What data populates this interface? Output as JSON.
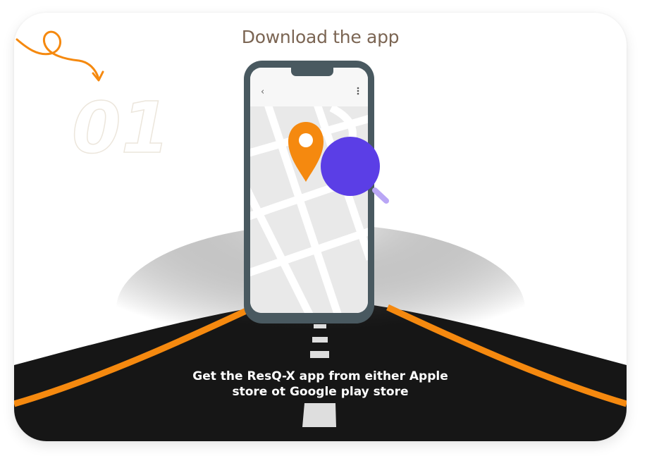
{
  "step": {
    "number": "01",
    "title": "Download the app",
    "description_line1": "Get the ResQ-X app from either Apple",
    "description_line2": "store ot Google play store"
  },
  "icons": {
    "swirl_arrow": "curly-arrow-icon",
    "location": "map-pin-icon",
    "search": "magnifier-icon",
    "back": "chevron-left-icon",
    "menu": "more-vertical-icon"
  },
  "colors": {
    "accent": "#f5890f",
    "purple": "#5b3ee6",
    "phone_frame": "#495960",
    "road": "#161616",
    "title": "#7b6553"
  }
}
